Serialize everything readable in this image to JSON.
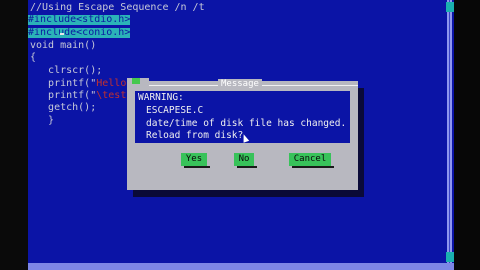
{
  "editor": {
    "lines": [
      {
        "text": "//Using Escape Sequence /n /t",
        "highlight": false
      },
      {
        "text": "#include<stdio.h>",
        "highlight": true
      },
      {
        "text": "#include<conio.h>",
        "highlight": true
      },
      {
        "text": "void main()",
        "highlight": false
      },
      {
        "text": "{",
        "highlight": false
      },
      {
        "text": "   clrscr();",
        "highlight": false
      },
      {
        "text": "   printf(\"",
        "highlight": false
      },
      {
        "text": "   printf(\"",
        "highlight": false
      },
      {
        "text": "   getch();",
        "highlight": false
      },
      {
        "text": "   }",
        "highlight": false
      }
    ],
    "string_fragments": [
      "Hello Fr",
      "\\test\");"
    ]
  },
  "dialog": {
    "title": "Message",
    "message_lines": [
      "WARNING:",
      "ESCAPESE.C",
      "date/time of disk file has changed.",
      "Reload from disk?"
    ],
    "buttons": {
      "yes": "Yes",
      "no": "No",
      "cancel": "Cancel"
    }
  },
  "colors": {
    "editor_bg": "#0b14a6",
    "highlight": "#2bb3b8",
    "dialog_bg": "#b8b8c0",
    "button": "#38c25a"
  }
}
